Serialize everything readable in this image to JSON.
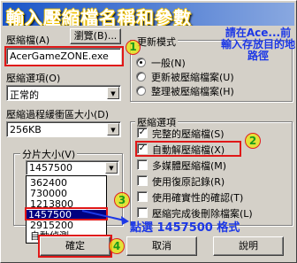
{
  "title": "輸入壓縮檔名稱和參數",
  "archive": {
    "label": "壓縮檔(A)",
    "browse_label": "瀏覽(B)...",
    "value": "AcerGameZONE.exe"
  },
  "options": {
    "label": "壓縮選項(O)",
    "value": "正常的"
  },
  "buffer": {
    "label": "壓縮過程緩衝區大小(D)",
    "value": "256KB"
  },
  "split": {
    "group_label": "分片大小(V)",
    "value": "1457500",
    "list": [
      "362400",
      "730000",
      "1213800",
      "1457500",
      "2915200",
      "自動偵測"
    ],
    "selected_index": 3
  },
  "update_mode": {
    "group_label": "更新模式",
    "items": [
      {
        "label": "一般(N)",
        "checked": true
      },
      {
        "label": "更新被壓縮檔案(U)",
        "checked": false
      },
      {
        "label": "整理被壓縮檔案(H)",
        "checked": false
      }
    ]
  },
  "archive_options": {
    "group_label": "壓縮選項",
    "items": [
      {
        "label": "完整的壓縮檔(S)",
        "checked": true
      },
      {
        "label": "自動解壓縮檔(X)",
        "checked": true
      },
      {
        "label": "多媒體壓縮檔(M)",
        "checked": false
      },
      {
        "label": "使用復原記錄(R)",
        "checked": false
      },
      {
        "label": "使用確實性的確認(T)",
        "checked": false
      },
      {
        "label": "壓縮完成後刪除檔案(L)",
        "checked": false
      }
    ]
  },
  "buttons": {
    "ok": "確定",
    "cancel": "取消",
    "help": "說明"
  },
  "annotations": {
    "note1": "請在Ace...前輸入存放目的地路徑",
    "note2": "點選 1457500 格式",
    "markers": [
      "1",
      "2",
      "3"
    ],
    "marker_bottom": "4",
    "colors": {
      "text": "#1d38e6",
      "highlight": "#e01818",
      "marker_fill": "#e6e614"
    }
  }
}
